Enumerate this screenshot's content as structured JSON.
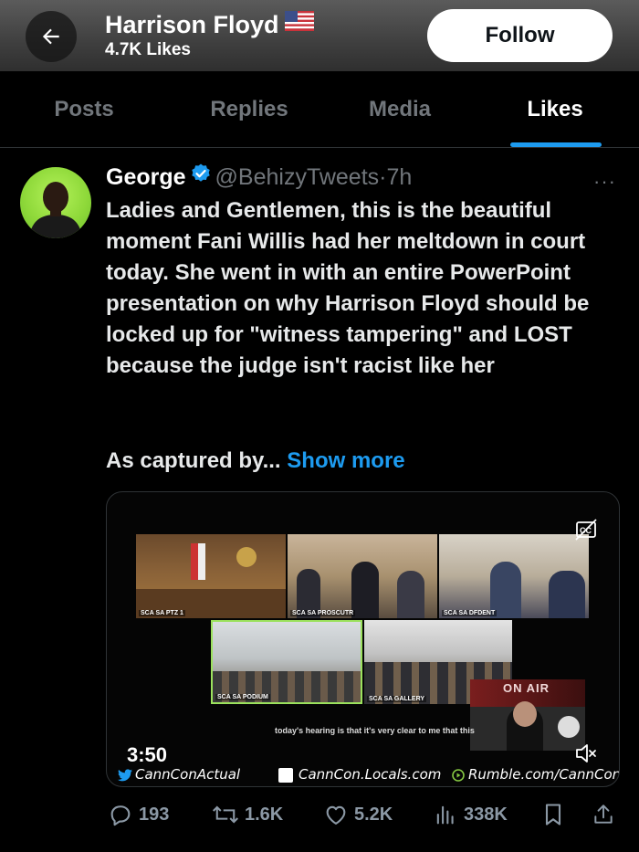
{
  "header": {
    "name": "Harrison Floyd",
    "flag": "🇺🇸",
    "likes": "4.7K Likes",
    "follow_label": "Follow"
  },
  "tabs": [
    {
      "label": "Posts"
    },
    {
      "label": "Replies"
    },
    {
      "label": "Media"
    },
    {
      "label": "Likes",
      "active": true
    }
  ],
  "tweet": {
    "name": "George",
    "handle": "@BehizyTweets",
    "dot": "·",
    "time": "7h",
    "text": "Ladies and Gentlemen, this is the beautiful moment Fani Willis had her meltdown in court today. She went in with an entire PowerPoint presentation on why Harrison Floyd should be locked up for \"witness tampering\" and LOST because the judge isn't racist like her",
    "text2": "As captured by...",
    "show_more": "Show more",
    "more_icon": "···"
  },
  "media": {
    "duration": "3:50",
    "caption": "today's hearing is that it's very clear to me that this",
    "panels": [
      {
        "label": "SCA SA PTZ 1"
      },
      {
        "label": "SCA SA PROSCUTR"
      },
      {
        "label": "SCA SA DFDENT"
      },
      {
        "label": "SCA SA PODIUM"
      },
      {
        "label": "SCA SA GALLERY"
      }
    ],
    "on_air": "ON AIR",
    "watermarks": {
      "twitter": "CannConActual",
      "locals": "CannCon.Locals.com",
      "rumble": "Rumble.com/CannCon"
    }
  },
  "actions": {
    "replies": "193",
    "reposts": "1.6K",
    "likes": "5.2K",
    "views": "338K"
  },
  "colors": {
    "accent": "#1d9bf0",
    "muted": "#71767b",
    "highlight_border": "#9be15d"
  }
}
